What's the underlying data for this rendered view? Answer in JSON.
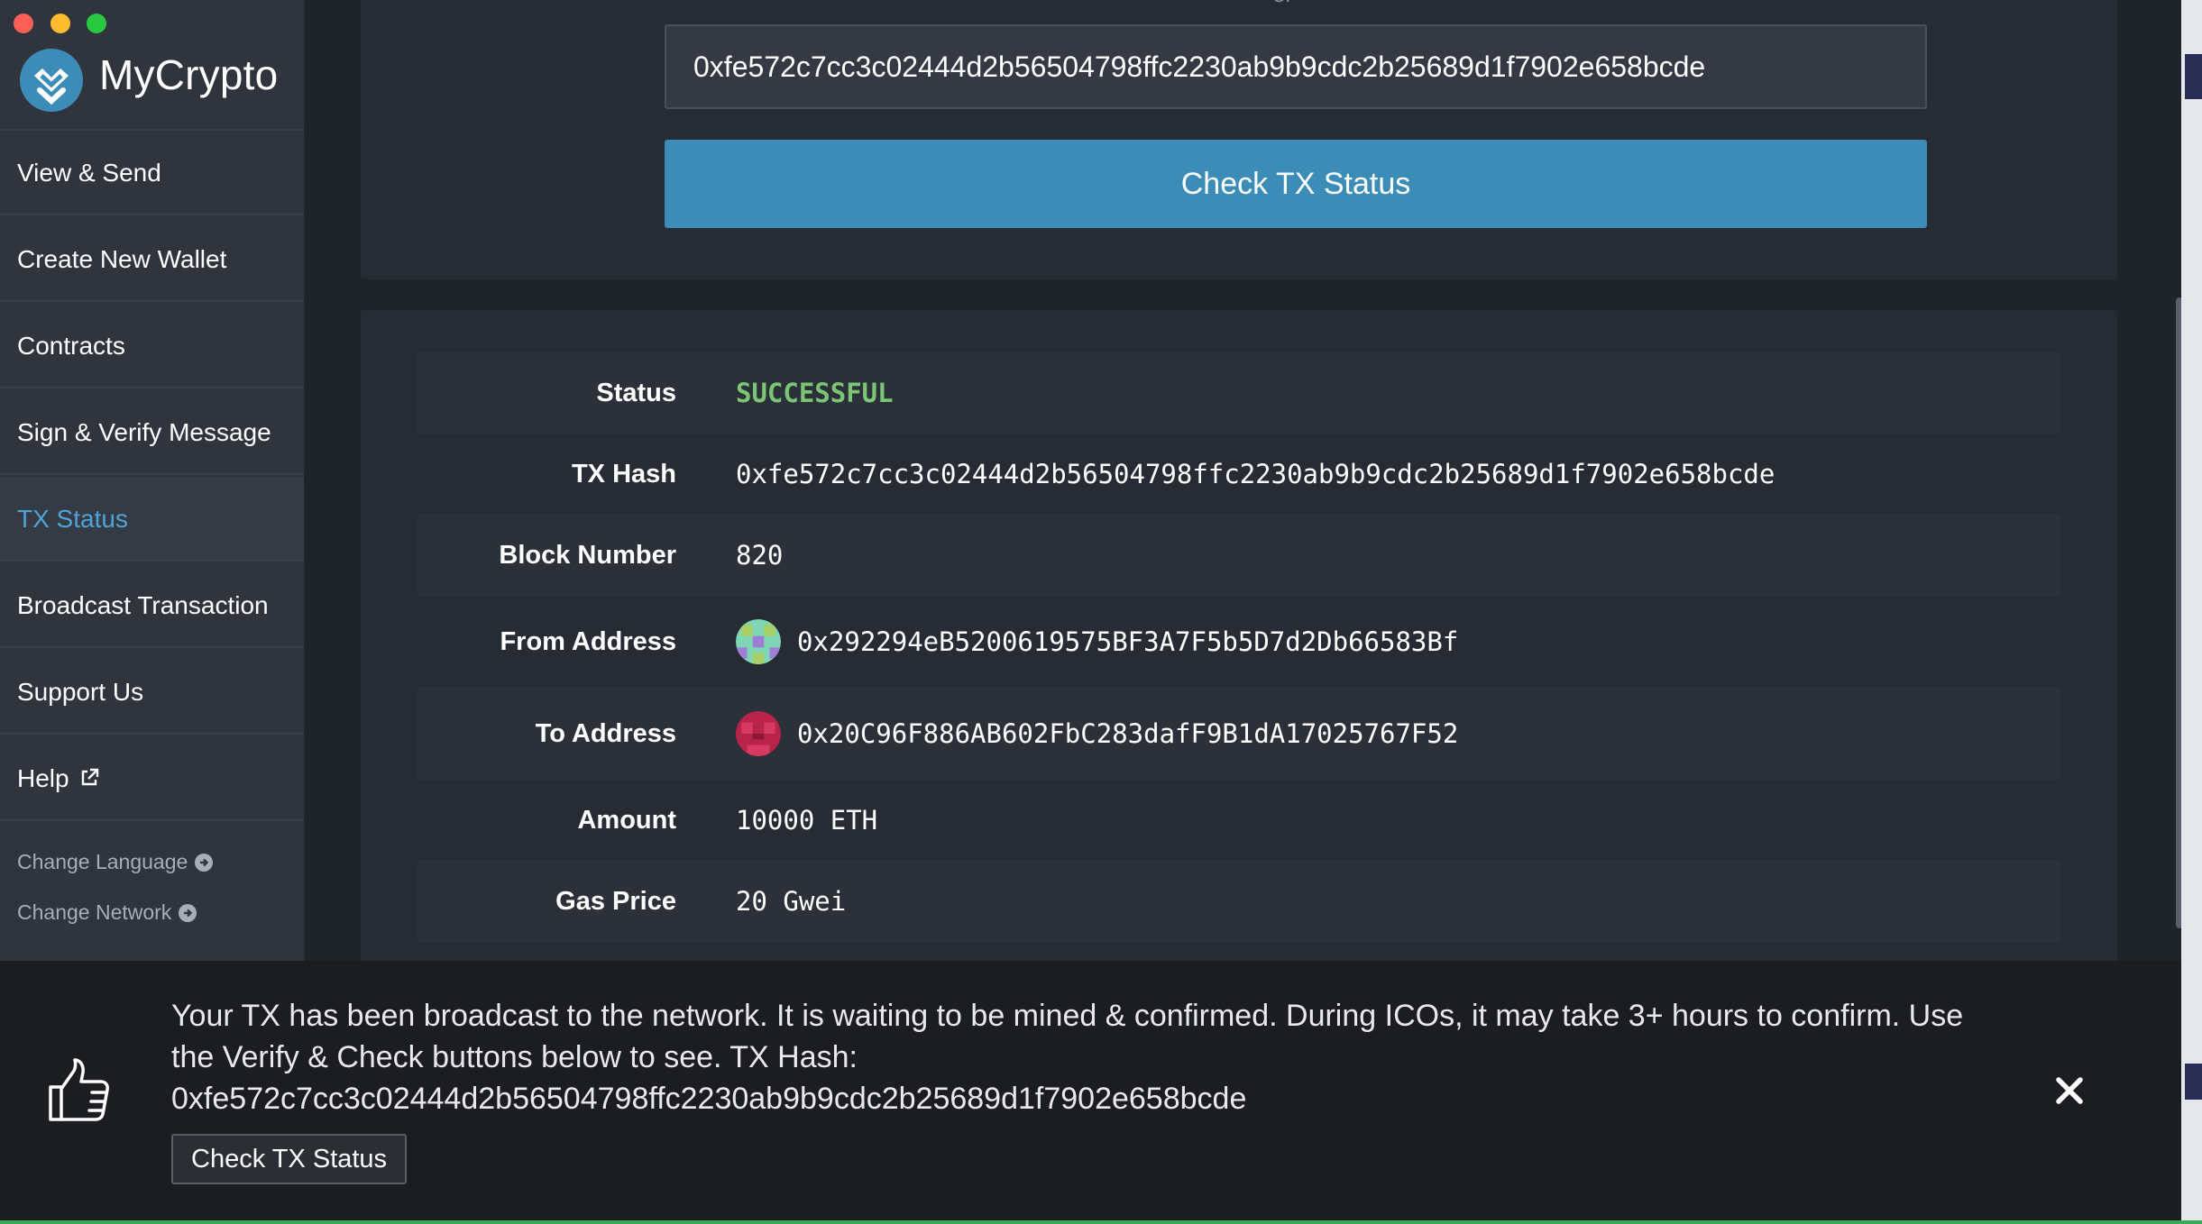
{
  "window": {
    "traffic_lights": [
      {
        "name": "close",
        "color": "#fe5f57"
      },
      {
        "name": "minimize",
        "color": "#febc2e"
      },
      {
        "name": "zoom",
        "color": "#28c840"
      }
    ]
  },
  "brand": {
    "name": "MyCrypto",
    "accent_color": "#3b8db8"
  },
  "sidebar": {
    "items": [
      {
        "label": "View & Send",
        "active": false
      },
      {
        "label": "Create New Wallet",
        "active": false
      },
      {
        "label": "Contracts",
        "active": false
      },
      {
        "label": "Sign & Verify Message",
        "active": false
      },
      {
        "label": "TX Status",
        "active": true
      },
      {
        "label": "Broadcast Transaction",
        "active": false
      },
      {
        "label": "Support Us",
        "active": false
      },
      {
        "label": "Help",
        "active": false,
        "icon": "external-link-icon"
      }
    ],
    "footer_links": [
      {
        "label": "Change Language",
        "icon": "arrow-circle-right-icon"
      },
      {
        "label": "Change Network",
        "icon": "arrow-circle-right-icon"
      }
    ],
    "active_color": "#4fa3d5"
  },
  "lookup": {
    "divider_text": "or",
    "tx_hash_value": "0xfe572c7cc3c02444d2b56504798ffc2230ab9b9cdc2b25689d1f7902e658bcde",
    "check_button_label": "Check TX Status"
  },
  "details": {
    "rows": [
      {
        "label": "Status",
        "value": "SUCCESSFUL"
      },
      {
        "label": "TX Hash",
        "value": "0xfe572c7cc3c02444d2b56504798ffc2230ab9b9cdc2b25689d1f7902e658bcde"
      },
      {
        "label": "Block Number",
        "value": "820"
      },
      {
        "label": "From Address",
        "value": "0x292294eB5200619575BF3A7F5b5D7d2Db66583Bf",
        "icon": "identicon"
      },
      {
        "label": "To Address",
        "value": "0x20C96F886AB602FbC283dafF9B1dA17025767F52",
        "icon": "identicon"
      },
      {
        "label": "Amount",
        "value": "10000 ETH"
      },
      {
        "label": "Gas Price",
        "value": "20 Gwei"
      }
    ],
    "status_color": "#7cc576"
  },
  "notification": {
    "icon": "thumbs-up-icon",
    "message_line1": "Your TX has been broadcast to the network. It is waiting to be mined & confirmed. During ICOs, it may take 3+ hours to confirm. Use",
    "message_line2": "the Verify & Check buttons below to see. TX Hash:",
    "message_hash": "0xfe572c7cc3c02444d2b56504798ffc2230ab9b9cdc2b25689d1f7902e658bcde",
    "button_label": "Check TX Status",
    "close_icon": "close-icon"
  }
}
